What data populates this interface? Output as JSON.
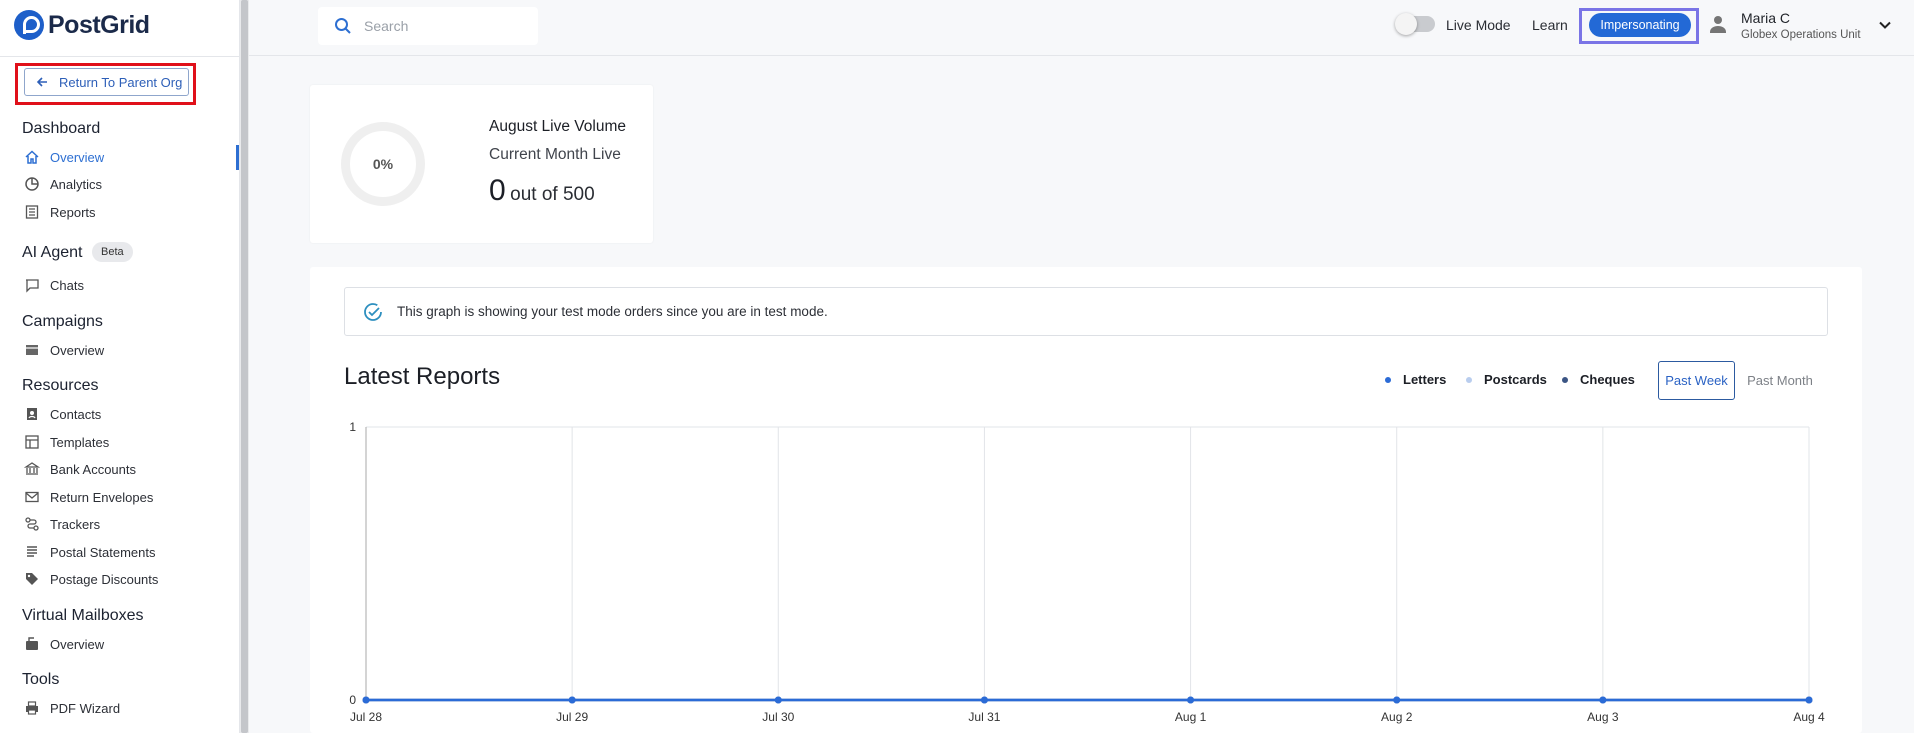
{
  "brand": {
    "name": "PostGrid"
  },
  "sidebar": {
    "return_button": "Return To Parent Org",
    "sections": [
      {
        "title": "Dashboard",
        "items": [
          "Overview",
          "Analytics",
          "Reports"
        ]
      },
      {
        "title": "AI Agent",
        "badge": "Beta",
        "items": [
          "Chats"
        ]
      },
      {
        "title": "Campaigns",
        "items": [
          "Overview"
        ]
      },
      {
        "title": "Resources",
        "items": [
          "Contacts",
          "Templates",
          "Bank Accounts",
          "Return Envelopes",
          "Trackers",
          "Postal Statements",
          "Postage Discounts"
        ]
      },
      {
        "title": "Virtual Mailboxes",
        "items": [
          "Overview"
        ]
      },
      {
        "title": "Tools",
        "items": [
          "PDF Wizard"
        ]
      }
    ],
    "active_item": "Dashboard / Overview",
    "icons": [
      "home-icon",
      "pie-chart-icon",
      "report-list-icon",
      "chat-bubble-icon",
      "mail-stack-icon",
      "contacts-icon",
      "template-icon",
      "bank-icon",
      "envelope-icon",
      "route-icon",
      "statement-icon",
      "tag-icon",
      "mailbox-icon",
      "printer-icon"
    ]
  },
  "header": {
    "search_placeholder": "Search",
    "live_mode_label": "Live Mode",
    "live_mode_on": false,
    "learn_label": "Learn",
    "impersonating_label": "Impersonating",
    "user_name": "Maria C",
    "user_org": "Globex Operations Unit"
  },
  "volume_card": {
    "percent_label": "0%",
    "title": "August Live Volume",
    "subtitle": "Current Month Live",
    "count": "0",
    "count_suffix": "out of 500"
  },
  "reports": {
    "notice": "This graph is showing your test mode orders since you are in test mode.",
    "title": "Latest Reports",
    "legend": [
      {
        "name": "Letters",
        "color": "#2b6bd6"
      },
      {
        "name": "Postcards",
        "color": "#b9cdee"
      },
      {
        "name": "Cheques",
        "color": "#3b5584"
      }
    ],
    "ranges": [
      "Past Week",
      "Past Month"
    ],
    "active_range": "Past Week"
  },
  "chart_data": {
    "type": "line",
    "categories": [
      "Jul 28",
      "Jul 29",
      "Jul 30",
      "Jul 31",
      "Aug 1",
      "Aug 2",
      "Aug 3",
      "Aug 4"
    ],
    "series": [
      {
        "name": "Letters",
        "values": [
          0,
          0,
          0,
          0,
          0,
          0,
          0,
          0
        ]
      },
      {
        "name": "Postcards",
        "values": [
          0,
          0,
          0,
          0,
          0,
          0,
          0,
          0
        ]
      },
      {
        "name": "Cheques",
        "values": [
          0,
          0,
          0,
          0,
          0,
          0,
          0,
          0
        ]
      }
    ],
    "ylim": [
      0,
      1
    ],
    "yticks": [
      "0",
      "1"
    ],
    "grid": true,
    "legend": "top-right"
  }
}
